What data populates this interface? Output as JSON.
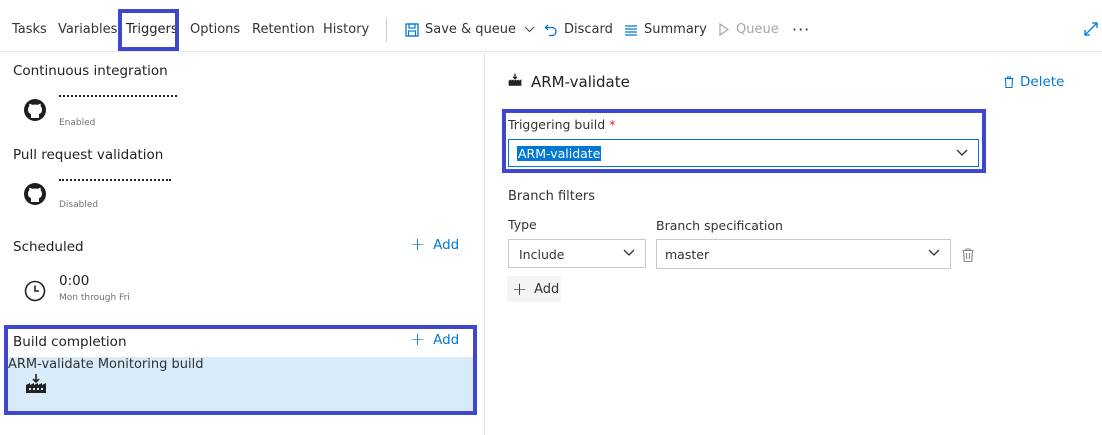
{
  "tabs": [
    {
      "label": "Tasks"
    },
    {
      "label": "Variables"
    },
    {
      "label": "Triggers",
      "active": true
    },
    {
      "label": "Options"
    },
    {
      "label": "Retention"
    },
    {
      "label": "History"
    }
  ],
  "toolbar": {
    "save_queue": "Save & queue",
    "discard": "Discard",
    "summary": "Summary",
    "queue": "Queue",
    "more": "···"
  },
  "left": {
    "ci": {
      "title": "Continuous integration",
      "item_status": "Enabled",
      "icon": "github-icon"
    },
    "pr": {
      "title": "Pull request validation",
      "item_status": "Disabled",
      "icon": "github-icon"
    },
    "scheduled": {
      "title": "Scheduled",
      "add_label": "Add",
      "item_time": "0:00",
      "item_days": "Mon through Fri",
      "icon": "clock-icon"
    },
    "build_completion": {
      "title": "Build completion",
      "add_label": "Add",
      "item_name": "ARM-validate",
      "item_status": "Monitoring build",
      "icon": "build-pipeline-icon"
    }
  },
  "right": {
    "title": "ARM-validate",
    "delete_label": "Delete",
    "triggering_build_label": "Triggering build",
    "required_mark": "*",
    "triggering_build_value": "ARM-validate",
    "branch_filters_label": "Branch filters",
    "type_label": "Type",
    "branch_spec_label": "Branch specification",
    "type_value": "Include",
    "branch_spec_value": "master",
    "add_label": "Add"
  },
  "colors": {
    "accent": "#0078d4",
    "highlight_border": "#3f48cc",
    "selected_row": "#d9ebf9"
  }
}
